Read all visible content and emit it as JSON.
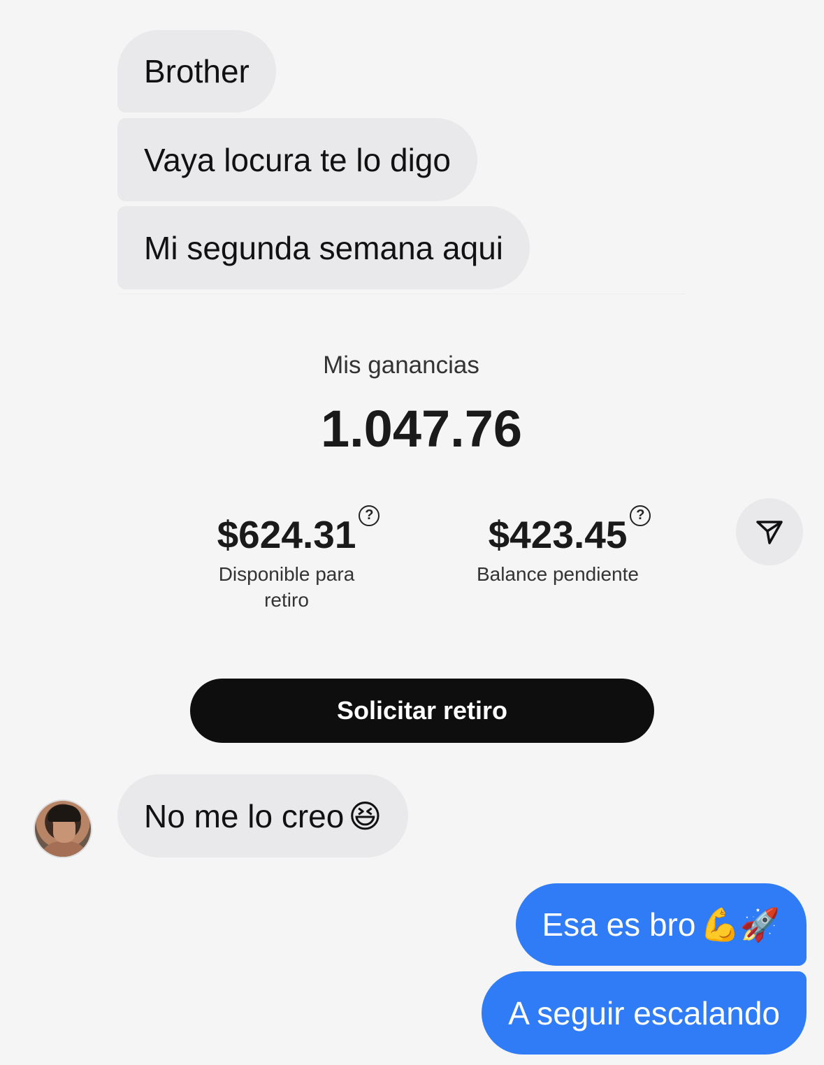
{
  "messages": {
    "incoming": [
      {
        "text": "Brother"
      },
      {
        "text": "Vaya locura te lo digo"
      },
      {
        "text": "Mi segunda semana aqui"
      },
      {
        "text": "No me lo creo",
        "emoji": "😆"
      }
    ],
    "outgoing": [
      {
        "text": "Esa es bro",
        "emoji": "💪🚀"
      },
      {
        "text": "A seguir escalando"
      }
    ]
  },
  "earnings_card": {
    "title": "Mis ganancias",
    "total": "1.047.76",
    "available": {
      "amount": "$624.31",
      "label": "Disponible para retiro"
    },
    "pending": {
      "amount": "$423.45",
      "label": "Balance pendiente"
    },
    "help_glyph": "?",
    "withdraw_button": "Solicitar retiro"
  },
  "colors": {
    "outgoing_bubble": "#2f7cf6",
    "incoming_bubble": "#e9e9ec",
    "background": "#f5f5f5",
    "button": "#0e0e0e"
  },
  "icons": {
    "share": "paper-plane-icon",
    "avatar": "contact-avatar"
  }
}
